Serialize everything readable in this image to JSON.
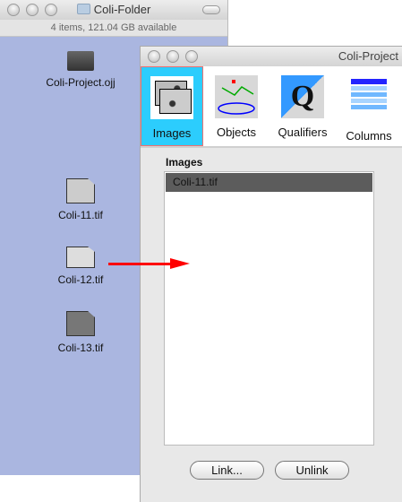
{
  "finder": {
    "title": "Coli-Folder",
    "status": "4 items, 121.04 GB available",
    "items": [
      {
        "label": "Coli-Project.ojj",
        "icon": "project-file-icon"
      },
      {
        "label": "Coli-11.tif",
        "icon": "tif-image-icon"
      },
      {
        "label": "Coli-12.tif",
        "icon": "tif-image-icon"
      },
      {
        "label": "Coli-13.tif",
        "icon": "tif-image-icon"
      }
    ]
  },
  "project": {
    "title": "Coli-Project",
    "tabs": [
      {
        "label": "Images",
        "selected": true
      },
      {
        "label": "Objects"
      },
      {
        "label": "Qualifiers"
      },
      {
        "label": "Columns"
      }
    ],
    "section_label": "Images",
    "list": [
      "Coli-11.tif"
    ],
    "link_label": "Link...",
    "unlink_label": "Unlink"
  },
  "colors": {
    "selected_tab": "#2ccdfd",
    "finder_bg": "#aab6e0",
    "arrow": "#ff0000",
    "selected_row": "#5c5c5c"
  }
}
